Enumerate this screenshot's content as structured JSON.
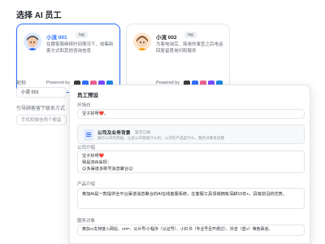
{
  "page": {
    "title": "选择 AI 员工"
  },
  "agents": [
    {
      "name": "小流 001",
      "tag": "tag",
      "description": "在跟客服继续时间情况下，收集新客方式和其他咨询信息",
      "powered_by": "Powered by",
      "selected": true
    },
    {
      "name": "小流 002",
      "tag": "tag",
      "description": "为客电询完、简单的事宜之后电话回复留意询问和服务",
      "powered_by": "Powered by",
      "selected": false
    }
  ],
  "form": {
    "nickname_label": "昵称",
    "nickname_value": "小流 001",
    "guide_label": "引导顾客留下联系方式",
    "guide_placeholder": "手机和微信两个都留"
  },
  "modal": {
    "title": "员工预设",
    "opening_label": "开场白",
    "opening_value": "宝子好呀❤️。",
    "knowledge": {
      "title": "公司及业务背景",
      "status": "是否已填",
      "description": "展示公司的简描，让此公司基础什么的，公司的产品是什么，服务对象等思路"
    },
    "company_label": "公司介绍",
    "company_lines": [
      "宝子好呀❤️",
      "我是流AI采现：",
      "😊多渠道多账号消息聚合😊"
    ],
    "product_label": "产品介绍",
    "product_value": "奥加AI是一款提供全平台渠道消息聚合的AI在线客服系统，在客服工具领域拥有深耕10年+，具有前沿的优势。",
    "service_label": "服务对象",
    "service_value": "奥加AI支持接入网站、APP、公众号/小程序（认证号）、小红书（专业号且开通过）、抖音（蓝V）等各渠道。"
  },
  "colors": {
    "accent": "#3370ff",
    "logo_colors": [
      "#3d3d3d",
      "#3370ff",
      "#f06292",
      "#7c4dff",
      "#1e88e5"
    ]
  },
  "icons": [
    "logo-icons",
    "knowledge-doc-icon"
  ]
}
